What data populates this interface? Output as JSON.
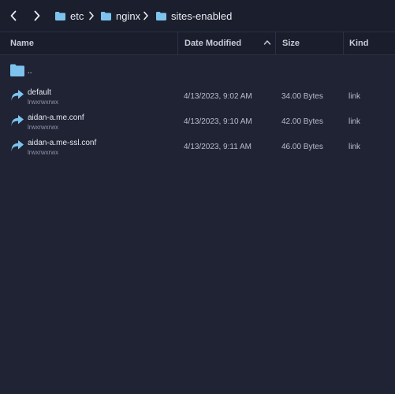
{
  "toolbar": {
    "back_icon": "chevron-left-icon",
    "forward_icon": "chevron-right-icon",
    "breadcrumb": [
      {
        "label": "etc",
        "icon": "folder-icon"
      },
      {
        "label": "nginx",
        "icon": "folder-icon"
      },
      {
        "label": "sites-enabled",
        "icon": "folder-icon"
      }
    ]
  },
  "columns": {
    "name": "Name",
    "date": "Date Modified",
    "size": "Size",
    "kind": "Kind",
    "sort_icon": "chevron-up-icon"
  },
  "rows": [
    {
      "name": "..",
      "icon": "folder-icon",
      "perm": "",
      "date": "",
      "size": "",
      "kind": ""
    },
    {
      "name": "default",
      "icon": "link-arrow-icon",
      "perm": "lrwxrwxrwx",
      "date": "4/13/2023, 9:02 AM",
      "size": "34.00 Bytes",
      "kind": "link"
    },
    {
      "name": "aidan-a.me.conf",
      "icon": "link-arrow-icon",
      "perm": "lrwxrwxrwx",
      "date": "4/13/2023, 9:10 AM",
      "size": "42.00 Bytes",
      "kind": "link"
    },
    {
      "name": "aidan-a.me-ssl.conf",
      "icon": "link-arrow-icon",
      "perm": "lrwxrwxrwx",
      "date": "4/13/2023, 9:11 AM",
      "size": "46.00 Bytes",
      "kind": "link"
    }
  ],
  "colors": {
    "background": "#1f2334",
    "folder": "#7ec3ee",
    "text": "#e6e8ef",
    "muted": "#8f95a8"
  }
}
